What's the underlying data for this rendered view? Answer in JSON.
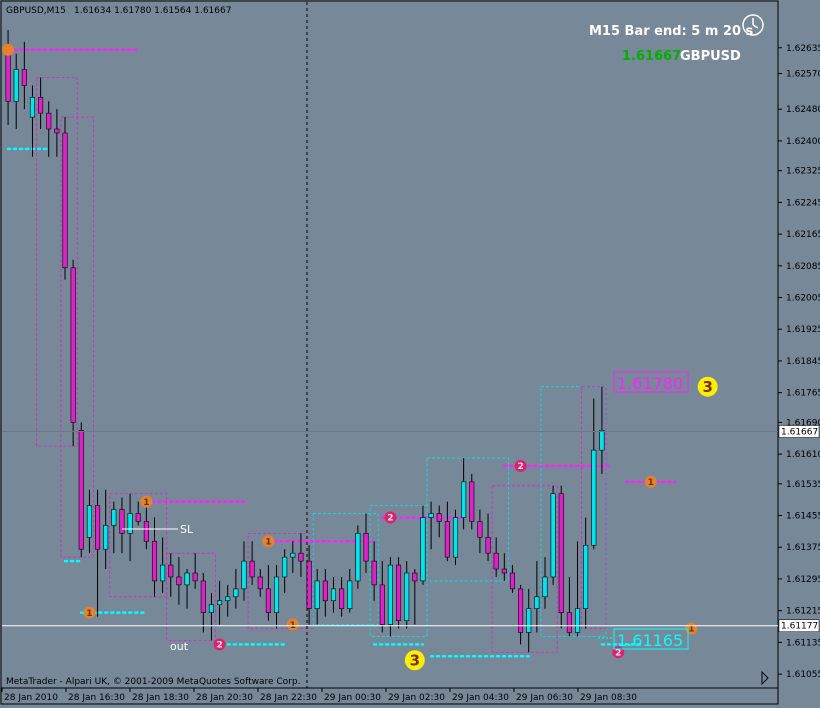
{
  "header": {
    "symbol_timeframe": "GBPUSD,M15",
    "ohlc": "1.61634 1.61780 1.61564 1.61667"
  },
  "info_panel": {
    "bar_end": "M15 Bar end: 5 m 20 s",
    "price": "1.61667",
    "symbol": "GBPUSD"
  },
  "copyright": "MetaTrader - Alpari UK, © 2001-2009 MetaQuotes Software Corp.",
  "labels": {
    "sl": "SL",
    "out": "out",
    "price_high_box": "1.61780",
    "price_low_box": "1.61165"
  },
  "colors": {
    "background": "#778899",
    "bull": "#00e5ee",
    "bear": "#e020c8",
    "magenta_level": "#ff20ff",
    "cyan_level": "#00ffff",
    "marker_orange": "#e8822a",
    "marker_pink": "#d8246c",
    "marker_yellow": "#ffee00",
    "price_text_green": "#00b000"
  },
  "chart_data": {
    "type": "candlestick",
    "y_axis_ticks": [
      "1.62635",
      "1.62570",
      "1.62480",
      "1.62400",
      "1.62325",
      "1.62245",
      "1.62165",
      "1.62085",
      "1.62005",
      "1.61925",
      "1.61845",
      "1.61765",
      "1.61690",
      "1.61610",
      "1.61535",
      "1.61455",
      "1.61375",
      "1.61295",
      "1.61215",
      "1.61135",
      "1.61055"
    ],
    "current_price_label": "1.61667",
    "horizontal_line_label": "1.61177",
    "ylim": [
      1.6103,
      1.627
    ],
    "x_axis_ticks": [
      "28 Jan 2010",
      "28 Jan 16:30",
      "28 Jan 18:30",
      "28 Jan 20:30",
      "28 Jan 22:30",
      "29 Jan 00:30",
      "29 Jan 02:30",
      "29 Jan 04:30",
      "29 Jan 06:30",
      "29 Jan 08:30"
    ],
    "candles": [
      {
        "o": 1.6262,
        "h": 1.6268,
        "l": 1.6244,
        "c": 1.625
      },
      {
        "o": 1.625,
        "h": 1.6262,
        "l": 1.6243,
        "c": 1.6258
      },
      {
        "o": 1.6258,
        "h": 1.6265,
        "l": 1.6248,
        "c": 1.6254
      },
      {
        "o": 1.6246,
        "h": 1.6254,
        "l": 1.6236,
        "c": 1.6251
      },
      {
        "o": 1.6251,
        "h": 1.6256,
        "l": 1.6243,
        "c": 1.6247
      },
      {
        "o": 1.6247,
        "h": 1.625,
        "l": 1.6236,
        "c": 1.6243
      },
      {
        "o": 1.6243,
        "h": 1.6248,
        "l": 1.6236,
        "c": 1.6242
      },
      {
        "o": 1.6242,
        "h": 1.6246,
        "l": 1.6205,
        "c": 1.6208
      },
      {
        "o": 1.6208,
        "h": 1.621,
        "l": 1.6163,
        "c": 1.6169
      },
      {
        "o": 1.6167,
        "h": 1.6169,
        "l": 1.6135,
        "c": 1.6137
      },
      {
        "o": 1.614,
        "h": 1.6152,
        "l": 1.6136,
        "c": 1.6148
      },
      {
        "o": 1.6148,
        "h": 1.6152,
        "l": 1.612,
        "c": 1.6137
      },
      {
        "o": 1.6137,
        "h": 1.6152,
        "l": 1.6132,
        "c": 1.6143
      },
      {
        "o": 1.6143,
        "h": 1.6149,
        "l": 1.6136,
        "c": 1.6147
      },
      {
        "o": 1.6147,
        "h": 1.615,
        "l": 1.6136,
        "c": 1.6141
      },
      {
        "o": 1.6141,
        "h": 1.6151,
        "l": 1.6134,
        "c": 1.6146
      },
      {
        "o": 1.6146,
        "h": 1.6149,
        "l": 1.6143,
        "c": 1.6144
      },
      {
        "o": 1.6144,
        "h": 1.6148,
        "l": 1.6137,
        "c": 1.6139
      },
      {
        "o": 1.6139,
        "h": 1.6145,
        "l": 1.6125,
        "c": 1.6129
      },
      {
        "o": 1.6129,
        "h": 1.614,
        "l": 1.6126,
        "c": 1.6133
      },
      {
        "o": 1.6133,
        "h": 1.6136,
        "l": 1.6125,
        "c": 1.613
      },
      {
        "o": 1.613,
        "h": 1.6135,
        "l": 1.6123,
        "c": 1.6128
      },
      {
        "o": 1.6128,
        "h": 1.6132,
        "l": 1.6122,
        "c": 1.6131
      },
      {
        "o": 1.6131,
        "h": 1.6136,
        "l": 1.6127,
        "c": 1.6129
      },
      {
        "o": 1.6129,
        "h": 1.6131,
        "l": 1.6116,
        "c": 1.6121
      },
      {
        "o": 1.6121,
        "h": 1.6126,
        "l": 1.6114,
        "c": 1.6123
      },
      {
        "o": 1.6123,
        "h": 1.6129,
        "l": 1.6118,
        "c": 1.6124
      },
      {
        "o": 1.6124,
        "h": 1.6128,
        "l": 1.612,
        "c": 1.6125
      },
      {
        "o": 1.6125,
        "h": 1.6132,
        "l": 1.6122,
        "c": 1.6127
      },
      {
        "o": 1.6127,
        "h": 1.6139,
        "l": 1.6124,
        "c": 1.6134
      },
      {
        "o": 1.6134,
        "h": 1.6139,
        "l": 1.6128,
        "c": 1.613
      },
      {
        "o": 1.613,
        "h": 1.6132,
        "l": 1.6125,
        "c": 1.6127
      },
      {
        "o": 1.6127,
        "h": 1.6133,
        "l": 1.6119,
        "c": 1.6121
      },
      {
        "o": 1.6121,
        "h": 1.6133,
        "l": 1.6117,
        "c": 1.613
      },
      {
        "o": 1.613,
        "h": 1.6137,
        "l": 1.6126,
        "c": 1.6135
      },
      {
        "o": 1.6135,
        "h": 1.6139,
        "l": 1.6131,
        "c": 1.6136
      },
      {
        "o": 1.6136,
        "h": 1.6141,
        "l": 1.613,
        "c": 1.6134
      },
      {
        "o": 1.6134,
        "h": 1.6138,
        "l": 1.6118,
        "c": 1.6122
      },
      {
        "o": 1.6122,
        "h": 1.6132,
        "l": 1.6118,
        "c": 1.6129
      },
      {
        "o": 1.6129,
        "h": 1.6132,
        "l": 1.612,
        "c": 1.6124
      },
      {
        "o": 1.6124,
        "h": 1.613,
        "l": 1.6121,
        "c": 1.6127
      },
      {
        "o": 1.6127,
        "h": 1.613,
        "l": 1.612,
        "c": 1.6122
      },
      {
        "o": 1.6122,
        "h": 1.6132,
        "l": 1.6121,
        "c": 1.6129
      },
      {
        "o": 1.6129,
        "h": 1.6143,
        "l": 1.6127,
        "c": 1.6141
      },
      {
        "o": 1.6141,
        "h": 1.6146,
        "l": 1.6131,
        "c": 1.6134
      },
      {
        "o": 1.6134,
        "h": 1.6139,
        "l": 1.6124,
        "c": 1.6128
      },
      {
        "o": 1.6128,
        "h": 1.6134,
        "l": 1.6116,
        "c": 1.6118
      },
      {
        "o": 1.6118,
        "h": 1.6135,
        "l": 1.6115,
        "c": 1.6133
      },
      {
        "o": 1.6133,
        "h": 1.6135,
        "l": 1.6117,
        "c": 1.6119
      },
      {
        "o": 1.6119,
        "h": 1.6134,
        "l": 1.6117,
        "c": 1.6131
      },
      {
        "o": 1.6131,
        "h": 1.6132,
        "l": 1.6118,
        "c": 1.6129
      },
      {
        "o": 1.6129,
        "h": 1.6148,
        "l": 1.6128,
        "c": 1.6145
      },
      {
        "o": 1.6145,
        "h": 1.6149,
        "l": 1.6137,
        "c": 1.6146
      },
      {
        "o": 1.6146,
        "h": 1.6148,
        "l": 1.614,
        "c": 1.6144
      },
      {
        "o": 1.6144,
        "h": 1.6149,
        "l": 1.6134,
        "c": 1.6135
      },
      {
        "o": 1.6135,
        "h": 1.6147,
        "l": 1.6133,
        "c": 1.6145
      },
      {
        "o": 1.6145,
        "h": 1.616,
        "l": 1.6142,
        "c": 1.6154
      },
      {
        "o": 1.6154,
        "h": 1.6156,
        "l": 1.6142,
        "c": 1.6144
      },
      {
        "o": 1.6144,
        "h": 1.6147,
        "l": 1.6136,
        "c": 1.614
      },
      {
        "o": 1.614,
        "h": 1.6146,
        "l": 1.6134,
        "c": 1.6136
      },
      {
        "o": 1.6136,
        "h": 1.614,
        "l": 1.613,
        "c": 1.6132
      },
      {
        "o": 1.6132,
        "h": 1.6136,
        "l": 1.6129,
        "c": 1.6131
      },
      {
        "o": 1.6131,
        "h": 1.6133,
        "l": 1.6126,
        "c": 1.6127
      },
      {
        "o": 1.6127,
        "h": 1.6128,
        "l": 1.6113,
        "c": 1.6116
      },
      {
        "o": 1.6116,
        "h": 1.6127,
        "l": 1.6111,
        "c": 1.6122
      },
      {
        "o": 1.6122,
        "h": 1.6134,
        "l": 1.6116,
        "c": 1.6125
      },
      {
        "o": 1.6125,
        "h": 1.6135,
        "l": 1.6122,
        "c": 1.613
      },
      {
        "o": 1.613,
        "h": 1.6153,
        "l": 1.6128,
        "c": 1.6151
      },
      {
        "o": 1.6151,
        "h": 1.6153,
        "l": 1.6117,
        "c": 1.6121
      },
      {
        "o": 1.6121,
        "h": 1.613,
        "l": 1.6115,
        "c": 1.6116
      },
      {
        "o": 1.6116,
        "h": 1.6139,
        "l": 1.6115,
        "c": 1.6122
      },
      {
        "o": 1.6122,
        "h": 1.6145,
        "l": 1.6117,
        "c": 1.6138
      },
      {
        "o": 1.6138,
        "h": 1.6175,
        "l": 1.6137,
        "c": 1.6162
      },
      {
        "o": 1.6162,
        "h": 1.6178,
        "l": 1.6156,
        "c": 1.6167
      }
    ],
    "levels": [
      {
        "color": "magenta",
        "price": 1.6263,
        "x_from_candle": 0,
        "x_to_candle": 16
      },
      {
        "color": "cyan",
        "price": 1.6238,
        "x_from_candle": 0,
        "x_to_candle": 5
      },
      {
        "color": "cyan",
        "price": 1.6134,
        "x_from_candle": 7,
        "x_to_candle": 9
      },
      {
        "color": "cyan",
        "price": 1.6121,
        "x_from_candle": 9,
        "x_to_candle": 17
      },
      {
        "color": "magenta",
        "price": 1.6149,
        "x_from_candle": 17,
        "x_to_candle": 29
      },
      {
        "color": "cyan",
        "price": 1.6113,
        "x_from_candle": 27,
        "x_to_candle": 34
      },
      {
        "color": "magenta",
        "price": 1.6139,
        "x_from_candle": 32,
        "x_to_candle": 45
      },
      {
        "color": "magenta",
        "price": 1.6145,
        "x_from_candle": 46,
        "x_to_candle": 56
      },
      {
        "color": "cyan",
        "price": 1.6113,
        "x_from_candle": 45,
        "x_to_candle": 51
      },
      {
        "color": "cyan",
        "price": 1.611,
        "x_from_candle": 52,
        "x_to_candle": 64
      },
      {
        "color": "magenta",
        "price": 1.6158,
        "x_from_candle": 61,
        "x_to_candle": 74
      },
      {
        "color": "magenta",
        "price": 1.6154,
        "x_from_candle": 76,
        "x_to_candle": 82
      },
      {
        "color": "cyan",
        "price": 1.6113,
        "x_from_candle": 73,
        "x_to_candle": 78
      }
    ],
    "markers": [
      {
        "label": "",
        "color": "orange",
        "candle": 0,
        "price": 1.6263
      },
      {
        "label": "1",
        "color": "orange",
        "candle": 17,
        "price": 1.6149
      },
      {
        "label": "1",
        "color": "orange",
        "candle": 10,
        "price": 1.6121
      },
      {
        "label": "1",
        "color": "orange",
        "candle": 32,
        "price": 1.6139
      },
      {
        "label": "1",
        "color": "orange",
        "candle": 35,
        "price": 1.6118
      },
      {
        "label": "2",
        "color": "pink",
        "candle": 47,
        "price": 1.6145
      },
      {
        "label": "2",
        "color": "pink",
        "candle": 26,
        "price": 1.6113
      },
      {
        "label": "2",
        "color": "pink",
        "candle": 63,
        "price": 1.6158
      },
      {
        "label": "2",
        "color": "pink",
        "candle": 75,
        "price": 1.6111
      },
      {
        "label": "1",
        "color": "orange",
        "candle": 79,
        "price": 1.6154
      },
      {
        "label": "1",
        "color": "orange",
        "candle": 84,
        "price": 1.6117
      },
      {
        "label": "3",
        "color": "yellow",
        "candle": 50,
        "price": 1.6109
      },
      {
        "label": "3",
        "color": "yellow",
        "candle": 86,
        "price": 1.6178
      }
    ]
  }
}
